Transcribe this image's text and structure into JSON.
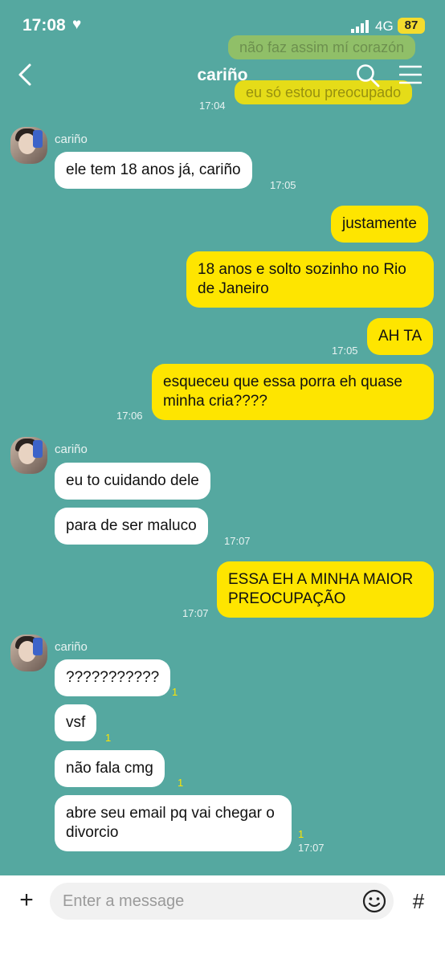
{
  "status": {
    "time": "17:08",
    "network": "4G",
    "battery": "87"
  },
  "header": {
    "title": "cariño"
  },
  "ghost_messages": [
    "não faz assim mí corazón",
    "eu só estou preocupado"
  ],
  "messages": {
    "t0": "17:04",
    "g1": {
      "sender": "cariño",
      "m1": "ele tem 18 anos já, cariño",
      "t1": "17:05"
    },
    "o1": "justamente",
    "o2": "18 anos e solto sozinho no Rio de Janeiro",
    "o3": "AH TA",
    "t_o3": "17:05",
    "o4": "esqueceu que essa porra eh quase minha cria????",
    "t_o4": "17:06",
    "g2": {
      "sender": "cariño",
      "m1": "eu to cuidando dele",
      "m2": "para de ser maluco",
      "t2": "17:07"
    },
    "o5": "ESSA EH A MINHA MAIOR PREOCUPAÇÃO",
    "t_o5": "17:07",
    "g3": {
      "sender": "cariño",
      "m1": "???????????",
      "r1": "1",
      "m2": "vsf",
      "r2": "1",
      "m3": "não fala cmg",
      "r3": "1",
      "m4": "abre seu email pq vai chegar o divorcio",
      "r4": "1",
      "t4": "17:07"
    }
  },
  "composer": {
    "placeholder": "Enter a message"
  },
  "colors": {
    "background": "#55a8a0",
    "outgoing": "#fee500",
    "incoming": "#ffffff"
  }
}
